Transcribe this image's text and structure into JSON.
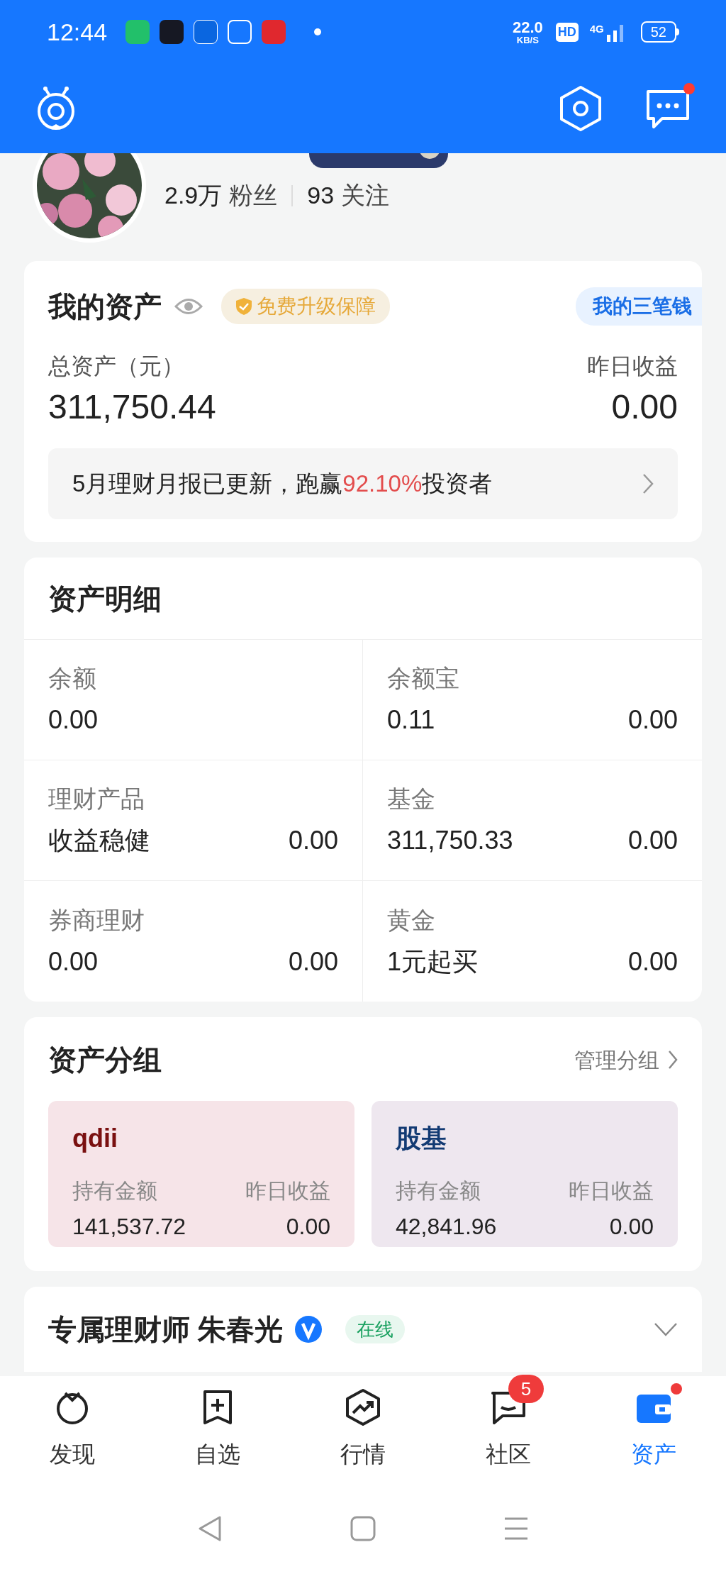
{
  "status_bar": {
    "time": "12:44",
    "net_speed": "22.0",
    "net_unit": "KB/S",
    "hd": "HD",
    "network": "4G",
    "battery": "52"
  },
  "header": {
    "messages_unread": true
  },
  "profile": {
    "followers_count": "2.9万",
    "followers_label": "粉丝",
    "following_count": "93",
    "following_label": "关注"
  },
  "assets": {
    "title": "我的资产",
    "protection_badge": "免费升级保障",
    "three_money_link": "我的三笔钱",
    "total_label": "总资产（元）",
    "total_value": "311,750.44",
    "yesterday_label": "昨日收益",
    "yesterday_value": "0.00",
    "report_before": "5月理财月报已更新，跑赢",
    "report_highlight": "92.10%",
    "report_after": "投资者"
  },
  "details": {
    "title": "资产明细",
    "items": [
      {
        "label": "余额",
        "value": "0.00"
      },
      {
        "label": "余额宝",
        "value": "0.11",
        "value_2": "0.00"
      },
      {
        "label": "理财产品",
        "value": "收益稳健",
        "value_2": "0.00"
      },
      {
        "label": "基金",
        "value": "311,750.33",
        "value_2": "0.00"
      },
      {
        "label": "券商理财",
        "value": "0.00",
        "value_2": "0.00"
      },
      {
        "label": "黄金",
        "value": "1元起买",
        "value_2": "0.00"
      }
    ]
  },
  "groups": {
    "title": "资产分组",
    "manage_link": "管理分组",
    "cards": [
      {
        "name": "qdii",
        "color": "#7a1010",
        "holding_label": "持有金额",
        "holding_value": "141,537.72",
        "yesterday_label": "昨日收益",
        "yesterday_value": "0.00"
      },
      {
        "name": "股基",
        "color": "#123a73",
        "holding_label": "持有金额",
        "holding_value": "42,841.96",
        "yesterday_label": "昨日收益",
        "yesterday_value": "0.00"
      }
    ]
  },
  "advisor": {
    "title": "专属理财师 朱春光",
    "verified": true,
    "status": "在线",
    "expanded": false
  },
  "nav": [
    {
      "kind": "discover",
      "label": "发现",
      "selected": false
    },
    {
      "kind": "watchlist",
      "label": "自选",
      "selected": false
    },
    {
      "kind": "market",
      "label": "行情",
      "selected": false
    },
    {
      "kind": "community",
      "label": "社区",
      "selected": false,
      "badge": "5"
    },
    {
      "kind": "assets",
      "label": "资产",
      "selected": true,
      "dot": true
    }
  ]
}
